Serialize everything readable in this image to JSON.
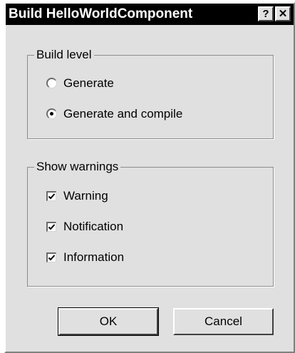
{
  "window": {
    "title": "Build HelloWorldComponent",
    "help_label": "?",
    "close_label": "✕"
  },
  "build_level": {
    "legend": "Build level",
    "options": [
      {
        "label": "Generate",
        "selected": false
      },
      {
        "label": "Generate and compile",
        "selected": true
      }
    ]
  },
  "show_warnings": {
    "legend": "Show warnings",
    "items": [
      {
        "label": "Warning",
        "checked": true
      },
      {
        "label": "Notification",
        "checked": true
      },
      {
        "label": "Information",
        "checked": true
      }
    ]
  },
  "buttons": {
    "ok_label": "OK",
    "cancel_label": "Cancel"
  }
}
